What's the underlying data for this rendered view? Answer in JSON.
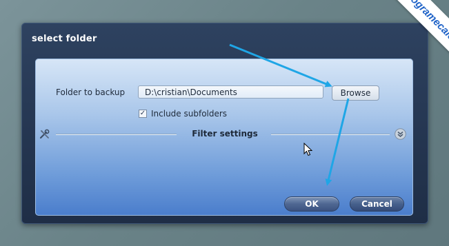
{
  "dialog": {
    "title": "select folder",
    "folder_label": "Folder to backup",
    "folder_path": "D:\\cristian\\Documents",
    "browse_label": "Browse",
    "include_subfolders_label": "Include subfolders",
    "include_subfolders_checked": true,
    "filter_settings_label": "Filter settings",
    "ok_label": "OK",
    "cancel_label": "Cancel"
  },
  "watermark": {
    "text": "programecalculator.ro"
  },
  "icons": [
    "tools-icon",
    "expand-chevron-icon",
    "mouse-cursor-icon",
    "checkmark-icon"
  ],
  "colors": {
    "dialog_bg": "#2e4260",
    "panel_top": "#d7e6f7",
    "panel_bottom": "#4a7dcc",
    "annotation_arrow": "#1fa6e6",
    "watermark_text": "#1f63c8"
  }
}
